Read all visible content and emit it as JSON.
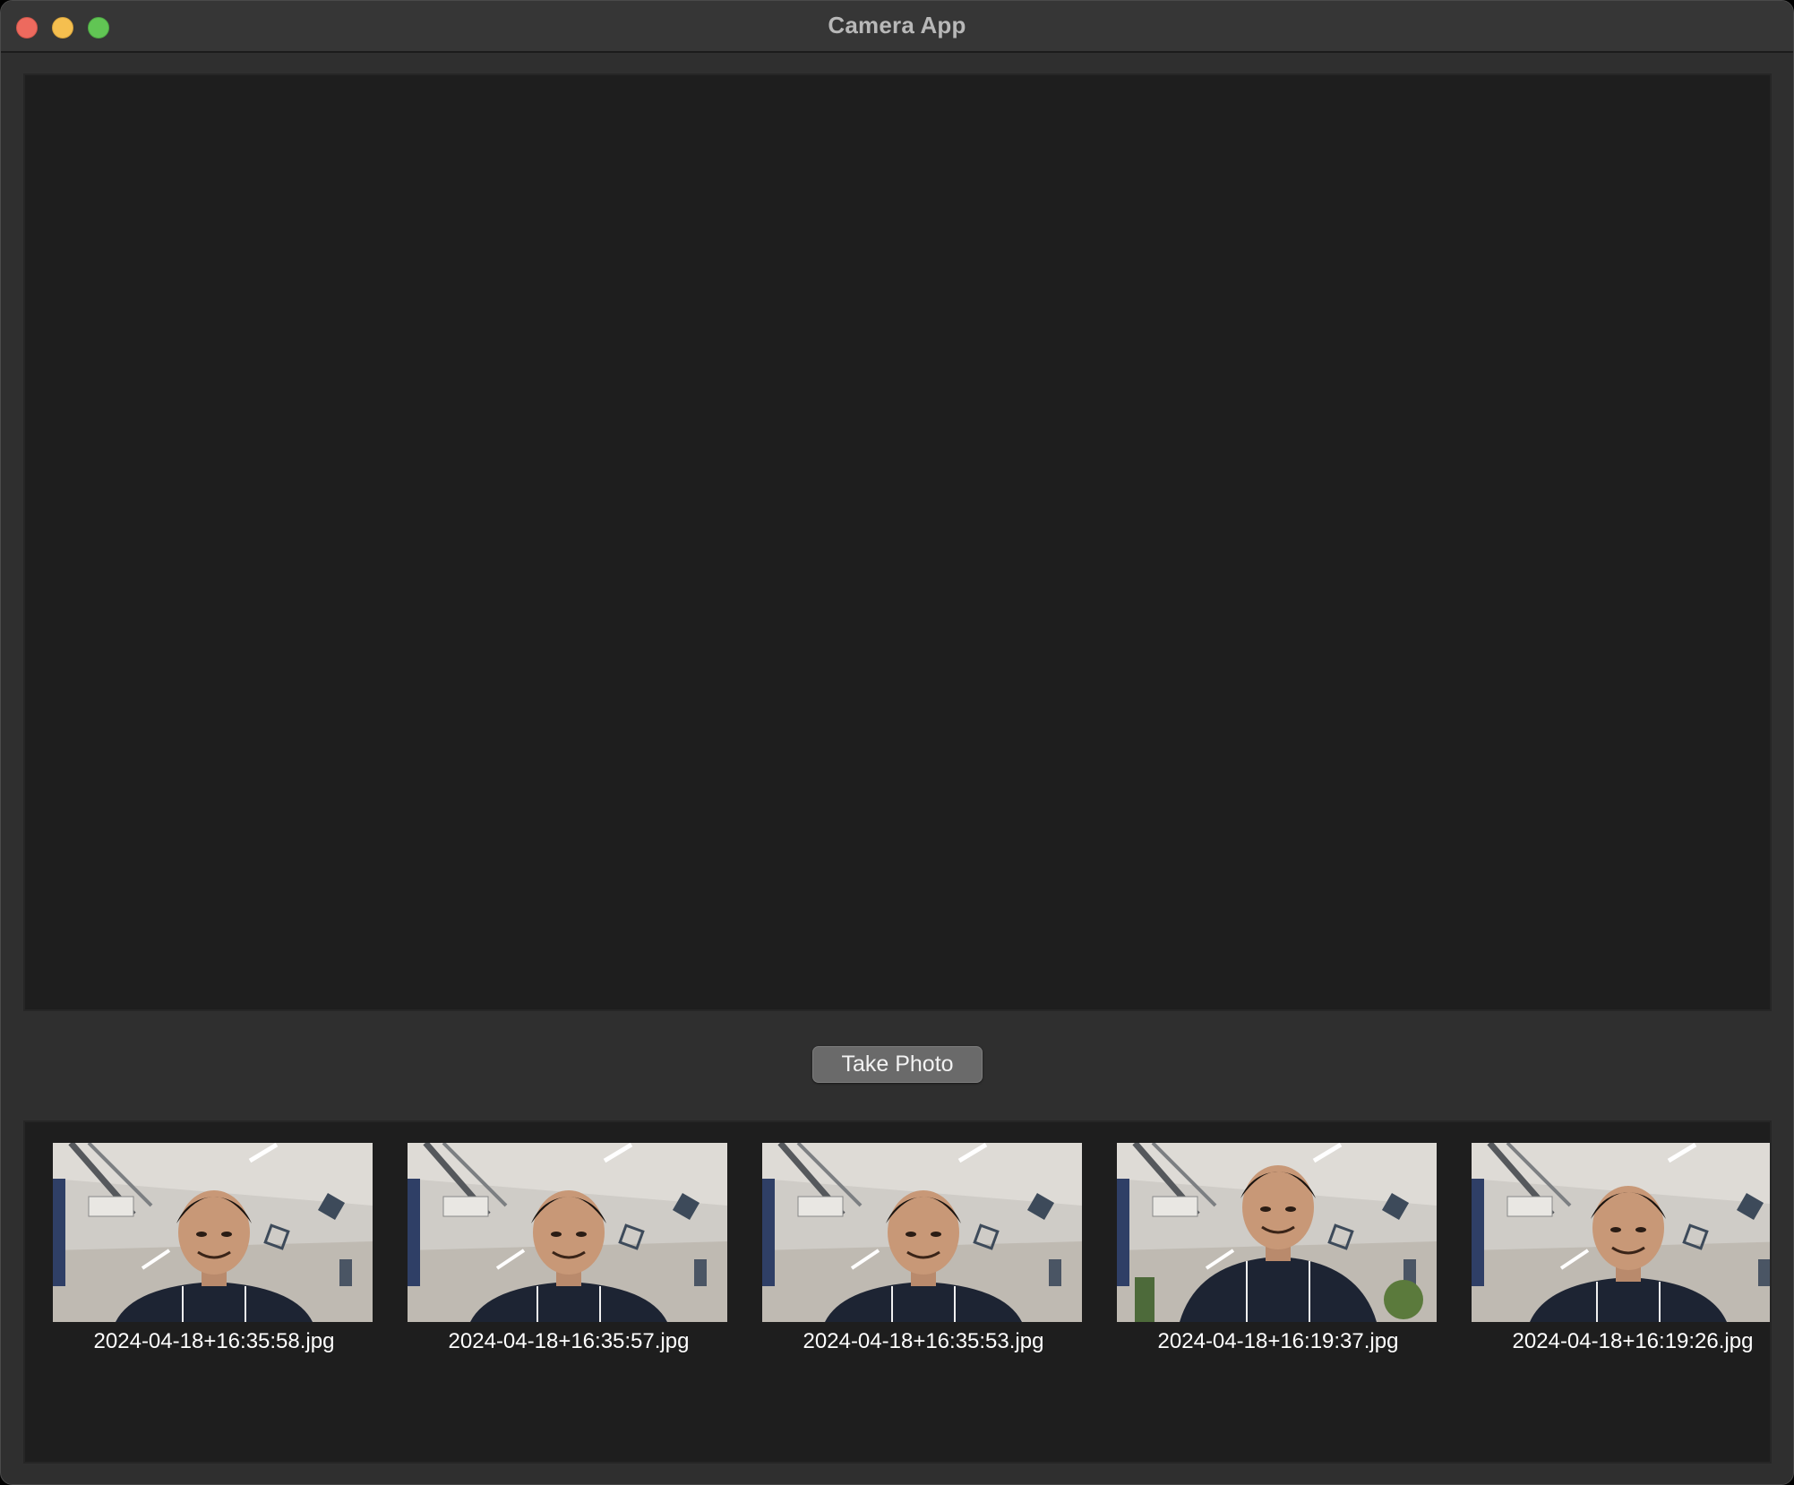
{
  "window": {
    "title": "Camera App"
  },
  "controls": {
    "take_photo_label": "Take Photo"
  },
  "gallery": {
    "photos": [
      {
        "filename": "2024-04-18+16:35:58.jpg"
      },
      {
        "filename": "2024-04-18+16:35:57.jpg"
      },
      {
        "filename": "2024-04-18+16:35:53.jpg"
      },
      {
        "filename": "2024-04-18+16:19:37.jpg"
      },
      {
        "filename": "2024-04-18+16:19:26.jpg"
      }
    ]
  },
  "colors": {
    "window_bg": "#2f2f2f",
    "panel_bg": "#1e1e1e",
    "button_bg": "#6a6a6a",
    "close": "#ed6a5e",
    "minimize": "#f5bf4f",
    "maximize": "#61c554"
  }
}
